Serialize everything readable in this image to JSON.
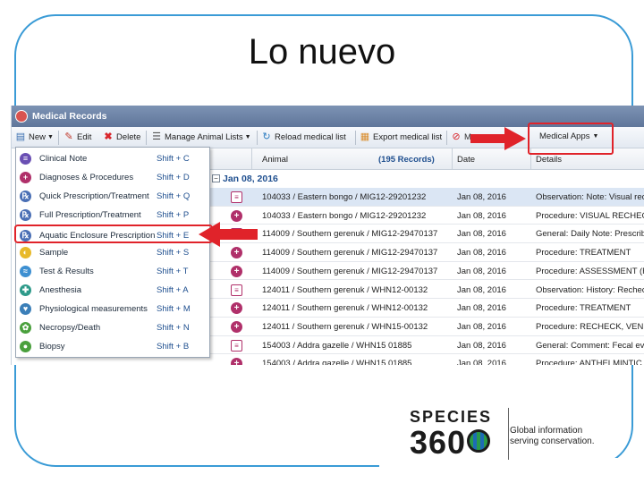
{
  "slide": {
    "title": "Lo nuevo"
  },
  "window": {
    "title": "Medical Records"
  },
  "toolbar": {
    "new": "New",
    "edit": "Edit",
    "delete": "Delete",
    "manage_lists": "Manage Animal Lists",
    "reload": "Reload medical list",
    "export": "Export medical list",
    "medical_apps": "Medical Apps"
  },
  "grid": {
    "headers": {
      "animal": "Animal",
      "records": "(195 Records)",
      "date": "Date",
      "details": "Details"
    },
    "group": "Jan 08, 2016",
    "rows": [
      {
        "kind": "obs",
        "animal": "104033 / Eastern bongo / MIG12-29201232",
        "date": "Jan 08, 2016",
        "details": "Observation: Note: Visual reche"
      },
      {
        "kind": "proc",
        "animal": "104033 / Eastern bongo / MIG12-29201232",
        "date": "Jan 08, 2016",
        "details": "Procedure: VISUAL RECHECK"
      },
      {
        "kind": "obs",
        "animal": "114009 / Southern gerenuk / MIG12-29470137",
        "date": "Jan 08, 2016",
        "details": "General: Daily Note: Prescribed"
      },
      {
        "kind": "proc",
        "animal": "114009 / Southern gerenuk / MIG12-29470137",
        "date": "Jan 08, 2016",
        "details": "Procedure: TREATMENT"
      },
      {
        "kind": "proc",
        "animal": "114009 / Southern gerenuk / MIG12-29470137",
        "date": "Jan 08, 2016",
        "details": "Procedure: ASSESSMENT (REC"
      },
      {
        "kind": "obs",
        "animal": "124011 / Southern gerenuk / WHN12-00132",
        "date": "Jan 08, 2016",
        "details": "Observation: History: Recheck"
      },
      {
        "kind": "proc",
        "animal": "124011 / Southern gerenuk / WHN12-00132",
        "date": "Jan 08, 2016",
        "details": "Procedure: TREATMENT"
      },
      {
        "kind": "proc",
        "animal": "124011 / Southern gerenuk / WHN15-00132",
        "date": "Jan 08, 2016",
        "details": "Procedure: RECHECK, VENIPU"
      },
      {
        "kind": "obs",
        "animal": "154003 / Addra gazelle / WHN15 01885",
        "date": "Jan 08, 2016",
        "details": "General: Comment: Fecal evalu"
      },
      {
        "kind": "proc",
        "animal": "154003 / Addra gazelle / WHN15 01885",
        "date": "Jan 08, 2016",
        "details": "Procedure: ANTHELMINTIC TR"
      }
    ]
  },
  "menu": {
    "items": [
      {
        "label": "Clinical Note",
        "shortcut": "Shift + C",
        "color": "#6a4fb3",
        "glyph": "≡"
      },
      {
        "label": "Diagnoses & Procedures",
        "shortcut": "Shift + D",
        "color": "#b0306a",
        "glyph": "+"
      },
      {
        "label": "Quick Prescription/Treatment",
        "shortcut": "Shift + Q",
        "color": "#4a6fb5",
        "glyph": "℞"
      },
      {
        "label": "Full Prescription/Treatment",
        "shortcut": "Shift + P",
        "color": "#4a6fb5",
        "glyph": "℞"
      },
      {
        "label": "Aquatic Enclosure Prescription",
        "shortcut": "Shift + E",
        "color": "#4a6fb5",
        "glyph": "℞"
      },
      {
        "label": "Sample",
        "shortcut": "Shift + S",
        "color": "#e8b92a",
        "glyph": "◐"
      },
      {
        "label": "Test & Results",
        "shortcut": "Shift + T",
        "color": "#3d8fd1",
        "glyph": "≈"
      },
      {
        "label": "Anesthesia",
        "shortcut": "Shift + A",
        "color": "#2e9a8a",
        "glyph": "✚"
      },
      {
        "label": "Physiological measurements",
        "shortcut": "Shift + M",
        "color": "#3b7fb8",
        "glyph": "♥"
      },
      {
        "label": "Necropsy/Death",
        "shortcut": "Shift + N",
        "color": "#4aa03d",
        "glyph": "✿"
      },
      {
        "label": "Biopsy",
        "shortcut": "Shift + B",
        "color": "#4aa03d",
        "glyph": "●"
      }
    ]
  },
  "logo": {
    "species": "SPECIES",
    "number": "360",
    "tagline_1": "Global information",
    "tagline_2": "serving conservation."
  },
  "colors": {
    "accent_red": "#e0232a",
    "frame_blue": "#3a9bd6",
    "header_blue": "#5f769a"
  }
}
